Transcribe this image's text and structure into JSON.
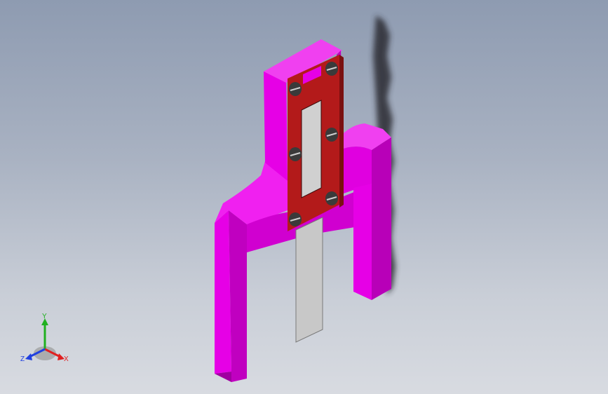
{
  "viewport": {
    "background_top": "#8e9bb1",
    "background_bottom": "#d8dbe1"
  },
  "model": {
    "body_color": "#e600e6",
    "body_side_color": "#b300b3",
    "clamp_plate_color": "#b31a1a",
    "blade_color": "#c8c8c8",
    "screw_color": "#3a3a3a",
    "screw_count": 6
  },
  "triad": {
    "x_label": "X",
    "y_label": "Y",
    "z_label": "Z",
    "x_color": "#e02020",
    "y_color": "#20b020",
    "z_color": "#2040e0"
  }
}
